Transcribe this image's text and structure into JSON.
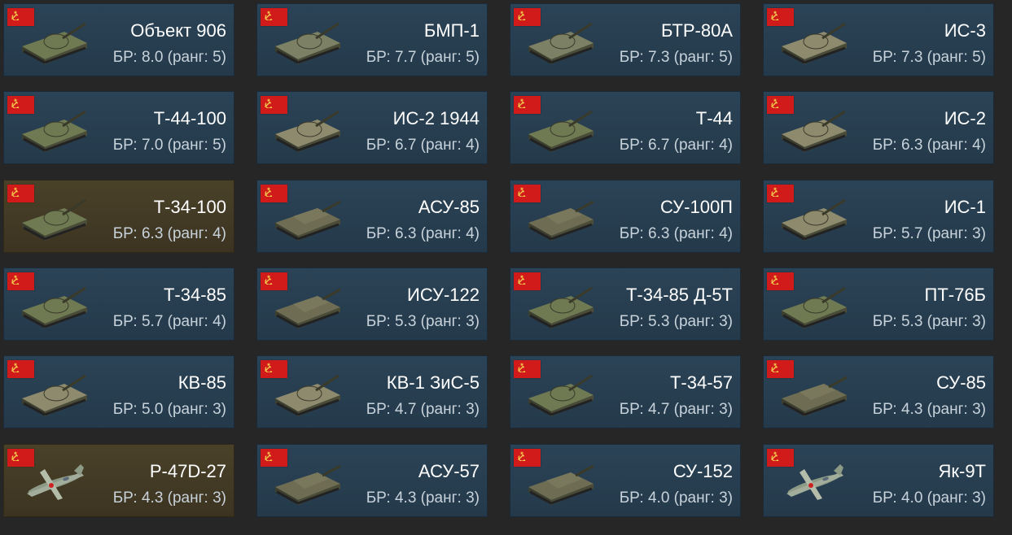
{
  "nation_flag_icon": "ussr-flag-icon",
  "colors": {
    "card_bg": "#2b4356",
    "premium_card_bg": "#4a4129",
    "flag_red": "#d11a1a",
    "flag_gold": "#f2c94c"
  },
  "vehicles": [
    {
      "name": "Объект 906",
      "br": "БР: 8.0 (ранг: 5)",
      "type": "light-tank",
      "premium": false
    },
    {
      "name": "БМП-1",
      "br": "БР: 7.7 (ранг: 5)",
      "type": "ifv",
      "premium": false
    },
    {
      "name": "БТР-80А",
      "br": "БР: 7.3 (ранг: 5)",
      "type": "apc",
      "premium": false
    },
    {
      "name": "ИС-3",
      "br": "БР: 7.3 (ранг: 5)",
      "type": "heavy-tank",
      "premium": false
    },
    {
      "name": "Т-44-100",
      "br": "БР: 7.0 (ранг: 5)",
      "type": "medium-tank",
      "premium": false
    },
    {
      "name": "ИС-2 1944",
      "br": "БР: 6.7 (ранг: 4)",
      "type": "heavy-tank",
      "premium": false
    },
    {
      "name": "Т-44",
      "br": "БР: 6.7 (ранг: 4)",
      "type": "medium-tank",
      "premium": false
    },
    {
      "name": "ИС-2",
      "br": "БР: 6.3 (ранг: 4)",
      "type": "heavy-tank",
      "premium": false
    },
    {
      "name": "Т-34-100",
      "br": "БР: 6.3 (ранг: 4)",
      "type": "medium-tank",
      "premium": true
    },
    {
      "name": "АСУ-85",
      "br": "БР: 6.3 (ранг: 4)",
      "type": "tank-destroyer",
      "premium": false
    },
    {
      "name": "СУ-100П",
      "br": "БР: 6.3 (ранг: 4)",
      "type": "tank-destroyer",
      "premium": false
    },
    {
      "name": "ИС-1",
      "br": "БР: 5.7 (ранг: 3)",
      "type": "heavy-tank",
      "premium": false
    },
    {
      "name": "Т-34-85",
      "br": "БР: 5.7 (ранг: 4)",
      "type": "medium-tank",
      "premium": false
    },
    {
      "name": "ИСУ-122",
      "br": "БР: 5.3 (ранг: 3)",
      "type": "tank-destroyer",
      "premium": false
    },
    {
      "name": "Т-34-85 Д-5Т",
      "br": "БР: 5.3 (ранг: 3)",
      "type": "medium-tank",
      "premium": false
    },
    {
      "name": "ПТ-76Б",
      "br": "БР: 5.3 (ранг: 3)",
      "type": "light-tank",
      "premium": false
    },
    {
      "name": "КВ-85",
      "br": "БР: 5.0 (ранг: 3)",
      "type": "heavy-tank",
      "premium": false
    },
    {
      "name": "КВ-1 ЗиС-5",
      "br": "БР: 4.7 (ранг: 3)",
      "type": "heavy-tank",
      "premium": false
    },
    {
      "name": "Т-34-57",
      "br": "БР: 4.7 (ранг: 3)",
      "type": "medium-tank",
      "premium": false
    },
    {
      "name": "СУ-85",
      "br": "БР: 4.3 (ранг: 3)",
      "type": "tank-destroyer",
      "premium": false
    },
    {
      "name": "P-47D-27",
      "br": "БР: 4.3 (ранг: 3)",
      "type": "aircraft",
      "premium": true
    },
    {
      "name": "АСУ-57",
      "br": "БР: 4.3 (ранг: 3)",
      "type": "tank-destroyer",
      "premium": false
    },
    {
      "name": "СУ-152",
      "br": "БР: 4.0 (ранг: 3)",
      "type": "tank-destroyer",
      "premium": false
    },
    {
      "name": "Як-9Т",
      "br": "БР: 4.0 (ранг: 3)",
      "type": "aircraft",
      "premium": false
    }
  ]
}
